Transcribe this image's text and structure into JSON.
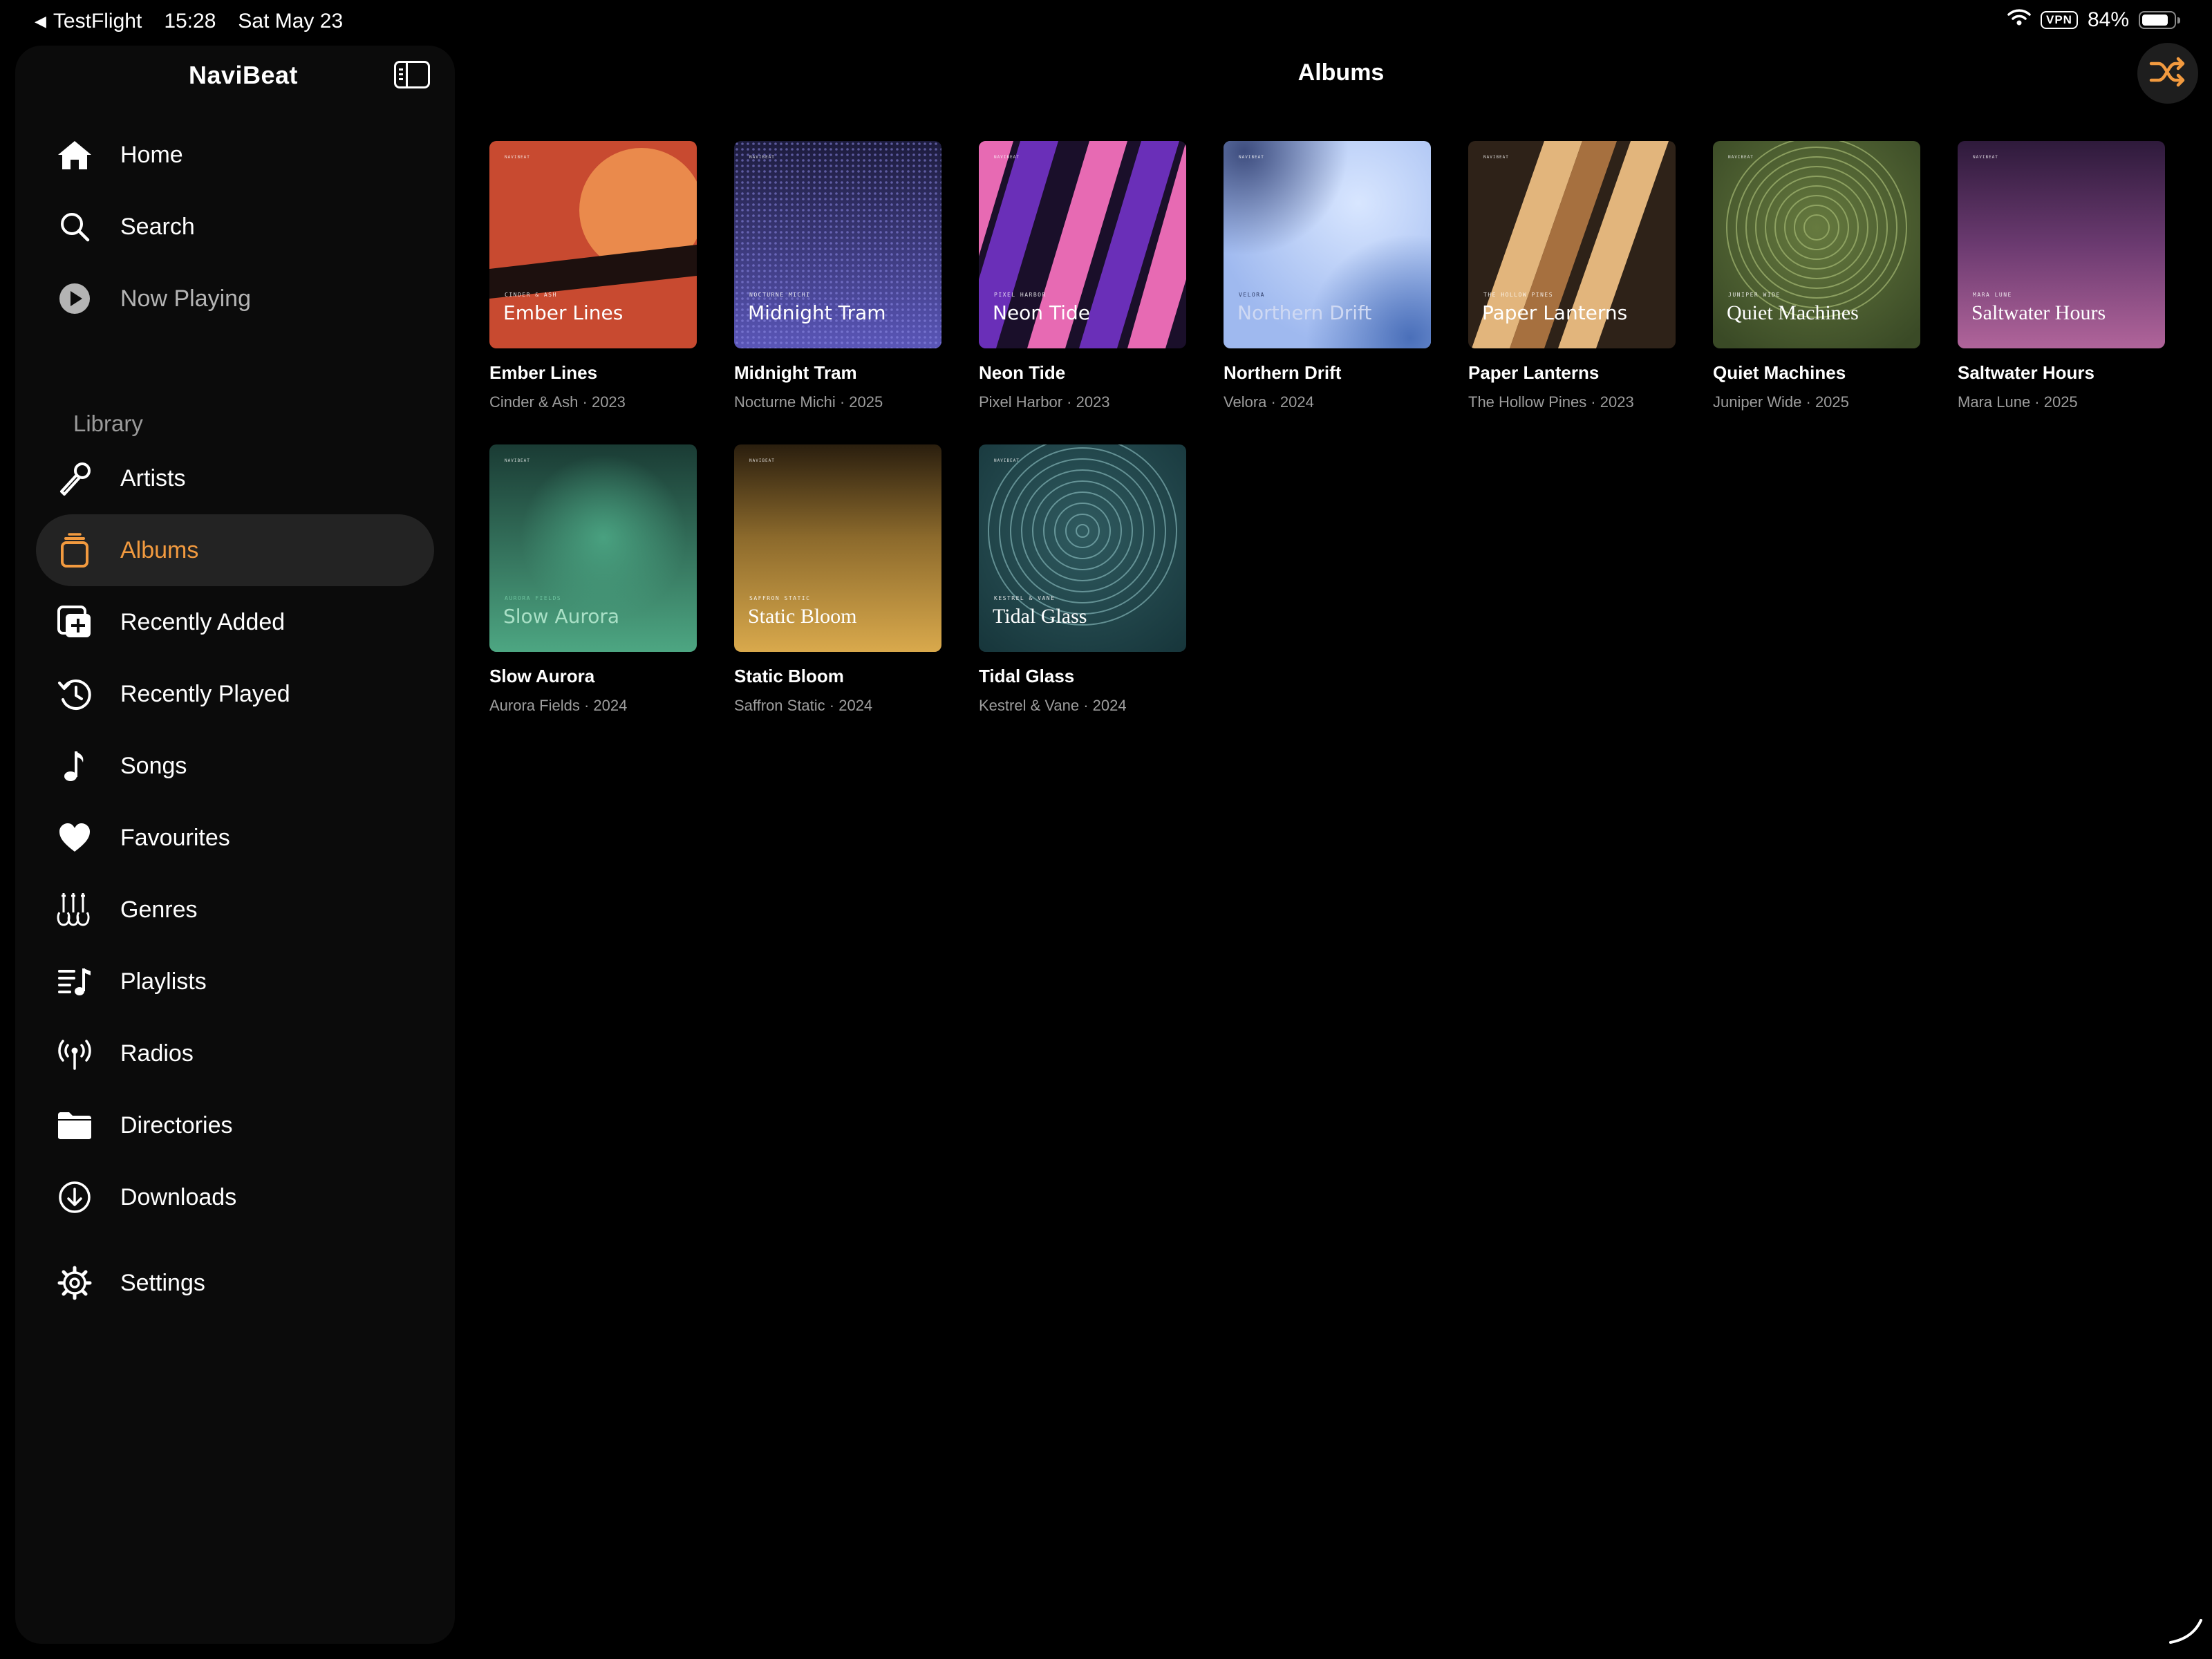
{
  "status_bar": {
    "back_app": "TestFlight",
    "time": "15:28",
    "date": "Sat May 23",
    "vpn": "VPN",
    "battery": "84%",
    "battery_level": 0.84
  },
  "sidebar": {
    "app_title": "NaviBeat",
    "primary_items": [
      {
        "label": "Home",
        "icon": "house-icon"
      },
      {
        "label": "Search",
        "icon": "magnifier-icon"
      },
      {
        "label": "Now Playing",
        "icon": "play-circle-icon"
      }
    ],
    "library_label": "Library",
    "library_items": [
      {
        "label": "Artists",
        "icon": "microphone-icon"
      },
      {
        "label": "Albums",
        "icon": "album-stack-icon",
        "selected": true
      },
      {
        "label": "Recently Added",
        "icon": "recently-added-icon"
      },
      {
        "label": "Recently Played",
        "icon": "history-icon"
      },
      {
        "label": "Songs",
        "icon": "music-note-icon"
      },
      {
        "label": "Favourites",
        "icon": "heart-icon"
      },
      {
        "label": "Genres",
        "icon": "guitars-icon"
      },
      {
        "label": "Playlists",
        "icon": "playlist-icon"
      },
      {
        "label": "Radios",
        "icon": "antenna-icon"
      },
      {
        "label": "Directories",
        "icon": "folder-icon"
      },
      {
        "label": "Downloads",
        "icon": "download-icon"
      }
    ],
    "settings": {
      "label": "Settings",
      "icon": "gear-icon"
    }
  },
  "main": {
    "title": "Albums",
    "albums": [
      {
        "title": "Ember Lines",
        "subtitle": "Cinder & Ash · 2023",
        "cover_title": "Ember Lines",
        "cover_artist": "CINDER & ASH"
      },
      {
        "title": "Midnight Tram",
        "subtitle": "Nocturne Michi · 2025",
        "cover_title": "Midnight Tram",
        "cover_artist": "NOCTURNE MICHI"
      },
      {
        "title": "Neon Tide",
        "subtitle": "Pixel Harbor · 2023",
        "cover_title": "Neon Tide",
        "cover_artist": "PIXEL HARBOR"
      },
      {
        "title": "Northern Drift",
        "subtitle": "Velora · 2024",
        "cover_title": "Northern Drift",
        "cover_artist": "VELORA"
      },
      {
        "title": "Paper Lanterns",
        "subtitle": "The Hollow Pines · 2023",
        "cover_title": "Paper Lanterns",
        "cover_artist": "THE HOLLOW PINES"
      },
      {
        "title": "Quiet Machines",
        "subtitle": "Juniper Wide · 2025",
        "cover_title": "Quiet Machines",
        "cover_artist": "JUNIPER WIDE"
      },
      {
        "title": "Saltwater Hours",
        "subtitle": "Mara Lune · 2025",
        "cover_title": "Saltwater Hours",
        "cover_artist": "MARA LUNE"
      },
      {
        "title": "Slow Aurora",
        "subtitle": "Aurora Fields · 2024",
        "cover_title": "Slow Aurora",
        "cover_artist": "AURORA FIELDS"
      },
      {
        "title": "Static Bloom",
        "subtitle": "Saffron Static · 2024",
        "cover_title": "Static Bloom",
        "cover_artist": "SAFFRON STATIC"
      },
      {
        "title": "Tidal Glass",
        "subtitle": "Kestrel & Vane · 2024",
        "cover_title": "Tidal Glass",
        "cover_artist": "KESTREL & VANE"
      }
    ],
    "cover_brand": "NAVIBEAT"
  },
  "colors": {
    "accent": "#f29a3f",
    "background": "#000000",
    "sidebar": "#0b0b0b",
    "selected_row": "#232323"
  }
}
